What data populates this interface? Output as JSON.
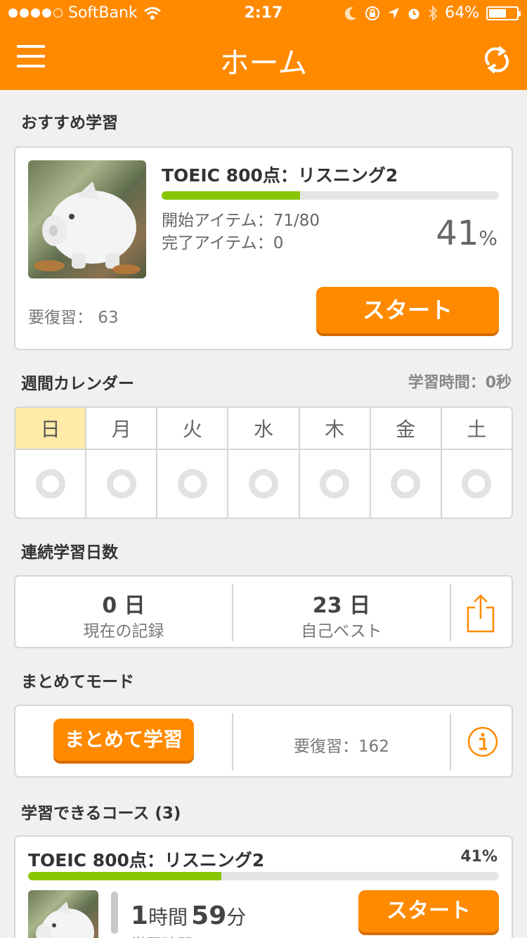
{
  "status": {
    "carrier": "SoftBank",
    "time": "2:17",
    "battery": "64%",
    "battery_level": 0.64
  },
  "nav": {
    "title": "ホーム"
  },
  "recommended": {
    "section_title": "おすすめ学習",
    "course_title": "TOEIC 800点：リスニング2",
    "progress": 0.41,
    "started_label": "開始アイテム：71/80",
    "done_label": "完了アイテム：0",
    "percent_value": "41",
    "percent_unit": "%",
    "review_label": "要復習： 63",
    "start_button": "スタート"
  },
  "calendar": {
    "section_title": "週間カレンダー",
    "study_time": "学習時間：0秒",
    "days": [
      "日",
      "月",
      "火",
      "水",
      "木",
      "金",
      "土"
    ]
  },
  "streak": {
    "section_title": "連続学習日数",
    "current_value": "0 日",
    "current_label": "現在の記録",
    "best_value": "23 日",
    "best_label": "自己ベスト"
  },
  "batch": {
    "section_title": "まとめてモード",
    "button": "まとめて学習",
    "review_label": "要復習：162"
  },
  "courses": {
    "section_title": "学習できるコース (3)",
    "items": [
      {
        "title": "TOEIC 800点：リスニング2",
        "percent": "41%",
        "progress": 0.41,
        "hours": "1",
        "hours_unit": "時間",
        "minutes": "59",
        "minutes_unit": "分",
        "time_label": "学習時間",
        "start_button": "スタート"
      }
    ]
  },
  "colors": {
    "accent": "#ff8a00",
    "progress": "#88c400",
    "today": "#ffeaa8"
  }
}
